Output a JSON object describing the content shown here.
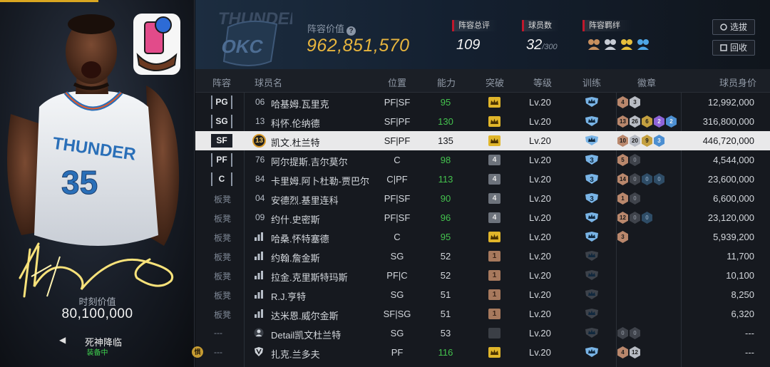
{
  "card": {
    "value_label": "时刻价值",
    "value": "80,100,000",
    "skill_name": "死神降临",
    "skill_status": "装备中",
    "arrow_left": "◀",
    "arrow_right": "▶",
    "player_number": "35",
    "jersey_text": "THUNDER"
  },
  "header": {
    "lineup_value_label": "阵容价值",
    "lineup_value": "962,851,570",
    "rating_label": "阵容总评",
    "rating_value": "109",
    "players_label": "球员数",
    "players_value": "32",
    "players_max": "/300",
    "bonds_label": "阵容羁绊",
    "btn_select": "选拔",
    "btn_recycle": "回收"
  },
  "columns": {
    "lineup": "阵容",
    "name": "球员名",
    "position": "位置",
    "ability": "能力",
    "breakthrough": "突破",
    "level": "等级",
    "training": "训练",
    "badges": "徽章",
    "value": "球员身价"
  },
  "rows": [
    {
      "slot": "PG",
      "num": "06",
      "name": "哈基姆.瓦里克",
      "pos": "PF|SF",
      "ability": "95",
      "green": true,
      "brk": "crown",
      "lv": "Lv.20",
      "train": "crown",
      "badges": [
        [
          "b",
          "4"
        ],
        [
          "s",
          "3"
        ]
      ],
      "value": "12,992,000"
    },
    {
      "slot": "SG",
      "num": "13",
      "name": "科怀.伦纳德",
      "pos": "SF|PF",
      "ability": "130",
      "green": true,
      "brk": "crown",
      "lv": "Lv.20",
      "train": "crown",
      "badges": [
        [
          "b",
          "13"
        ],
        [
          "s",
          "26"
        ],
        [
          "g",
          "6"
        ],
        [
          "p",
          "2"
        ],
        [
          "bl",
          "2"
        ]
      ],
      "value": "316,800,000"
    },
    {
      "slot": "SF",
      "num": "13",
      "name": "凯文.杜兰特",
      "pos": "SF|PF",
      "ability": "135",
      "green": false,
      "brk": "crown",
      "lv": "Lv.20",
      "train": "crown",
      "badges": [
        [
          "b",
          "10"
        ],
        [
          "s",
          "20"
        ],
        [
          "g",
          "9"
        ],
        [
          "bl",
          "3"
        ]
      ],
      "value": "446,720,000",
      "selected": true
    },
    {
      "slot": "PF",
      "num": "76",
      "name": "阿尔提斯.吉尔莫尔",
      "pos": "C",
      "ability": "98",
      "green": true,
      "brk": "4",
      "lv": "Lv.20",
      "train": "3",
      "badges": [
        [
          "b",
          "5"
        ],
        [
          "dk",
          "0"
        ]
      ],
      "value": "4,544,000"
    },
    {
      "slot": "C",
      "num": "84",
      "name": "卡里姆.阿卜杜勒-贾巴尔",
      "pos": "C|PF",
      "ability": "113",
      "green": true,
      "brk": "4",
      "lv": "Lv.20",
      "train": "3",
      "badges": [
        [
          "b",
          "14"
        ],
        [
          "dk",
          "0"
        ],
        [
          "dkb",
          "0"
        ],
        [
          "dkb",
          "0"
        ]
      ],
      "value": "23,600,000"
    },
    {
      "slot": "板凳",
      "num": "04",
      "name": "安德烈.基里连科",
      "pos": "PF|SF",
      "ability": "90",
      "green": true,
      "brk": "4",
      "lv": "Lv.20",
      "train": "3",
      "badges": [
        [
          "b",
          "1"
        ],
        [
          "dk",
          "0"
        ]
      ],
      "value": "6,600,000"
    },
    {
      "slot": "板凳",
      "num": "09",
      "name": "约什.史密斯",
      "pos": "PF|SF",
      "ability": "96",
      "green": true,
      "brk": "4",
      "lv": "Lv.20",
      "train": "crown",
      "badges": [
        [
          "b",
          "12"
        ],
        [
          "dk",
          "0"
        ],
        [
          "dkb",
          "0"
        ]
      ],
      "value": "23,120,000"
    },
    {
      "slot": "板凳",
      "num": "",
      "name": "哈桑.怀特塞德",
      "pos": "C",
      "ability": "95",
      "green": true,
      "brk": "crown",
      "lv": "Lv.20",
      "train": "crown",
      "badges": [
        [
          "b",
          "3"
        ]
      ],
      "value": "5,939,200"
    },
    {
      "slot": "板凳",
      "num": "",
      "name": "约翰.詹金斯",
      "pos": "SG",
      "ability": "52",
      "green": false,
      "brk": "1",
      "lv": "Lv.20",
      "train": "none",
      "badges": [],
      "value": "11,700"
    },
    {
      "slot": "板凳",
      "num": "",
      "name": "拉金.克里斯特玛斯",
      "pos": "PF|C",
      "ability": "52",
      "green": false,
      "brk": "1",
      "lv": "Lv.20",
      "train": "none",
      "badges": [],
      "value": "10,100"
    },
    {
      "slot": "板凳",
      "num": "",
      "name": "R.J.亨特",
      "pos": "SG",
      "ability": "51",
      "green": false,
      "brk": "1",
      "lv": "Lv.20",
      "train": "none",
      "badges": [],
      "value": "8,250"
    },
    {
      "slot": "板凳",
      "num": "",
      "name": "达米恩.威尔金斯",
      "pos": "SF|SG",
      "ability": "51",
      "green": false,
      "brk": "1",
      "lv": "Lv.20",
      "train": "none",
      "badges": [],
      "value": "6,320"
    },
    {
      "slot": "---",
      "num": "",
      "name": "Detail凯文杜兰特",
      "pos": "SG",
      "ability": "53",
      "green": false,
      "brk": "dark",
      "lv": "Lv.20",
      "train": "none",
      "badges": [
        [
          "dk",
          "0"
        ],
        [
          "dk",
          "0"
        ]
      ],
      "value": "---"
    },
    {
      "slot": "---",
      "num": "",
      "name": "扎克.兰多夫",
      "pos": "PF",
      "ability": "116",
      "green": true,
      "brk": "crown",
      "lv": "Lv.20",
      "train": "crown",
      "badges": [
        [
          "b",
          "4"
        ],
        [
          "s",
          "12"
        ]
      ],
      "value": "---",
      "side": "惧"
    }
  ],
  "row_icons": [
    "none",
    "none",
    "none",
    "none",
    "none",
    "none",
    "none",
    "bars",
    "bars",
    "bars",
    "bars",
    "bars",
    "person",
    "shield"
  ],
  "colors": {
    "accent_gold": "#e7b53e",
    "ability_green": "#44c24e",
    "selected_row": "#e9e9ea",
    "label_red": "#c0182c"
  }
}
